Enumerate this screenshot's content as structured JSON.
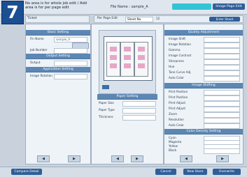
{
  "step": "7",
  "top": {
    "message": "No area is for whole job edit / Add area is for per page edit",
    "title_left": "Ticket",
    "file_name": "File Name : sample_A",
    "tab1": "",
    "tab2": "Image Page Edit",
    "tab_row_label": "Per Page Edit",
    "tab_row_value": "Sheet No.",
    "tab_row_num": "12",
    "enter_sheet": "Enter Sheet"
  },
  "left_panel": {
    "basic_header": "Basic Setting",
    "basic_row1": "Fin Name",
    "basic_row1_val": "sample_A",
    "basic_row2": "Job Number",
    "output_header": "Output Setting",
    "output_row1": "Output",
    "output_row1_val": "",
    "app_header": "Application Setting",
    "app_row1": "Image Rotation",
    "app_row1_val": ""
  },
  "center": {
    "paper_header": "Paper Setting",
    "paper_row1": "Paper Size",
    "paper_row2": "Paper Type",
    "paper_row3": "Thickness",
    "paper_val1": "",
    "paper_val2": "",
    "paper_val3": ""
  },
  "right_panel": {
    "quality_header": "Quality Adjustment",
    "image_header": "Image Shifting",
    "color_header": "Color Density Setting",
    "q_rows": [
      "Image Shift",
      "Image Rotation",
      "Gamma",
      "Image Contrast",
      "Sharpness",
      "Hue",
      "Tone Curve Adj.",
      "Auto Color"
    ],
    "i_rows": [
      "Print Position",
      "Print Position",
      "Print Adjust",
      "Print Adjust",
      "Zoom",
      "Resolution",
      "Auto Color"
    ],
    "c_rows": [
      "Cyan",
      "Magenta",
      "Yellow",
      "Black"
    ]
  },
  "bottom": {
    "left_btn": "Compare Detail",
    "cancel": "Cancel",
    "new_store": "New Store",
    "overwrite": "Overwrite"
  },
  "colors": {
    "accent": "#5d87b3",
    "step": "#1b4f92",
    "tab_active": "#34c3d6",
    "button_blue": "#2f5f99"
  }
}
